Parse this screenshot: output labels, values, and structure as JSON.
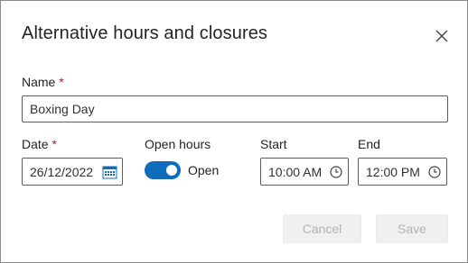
{
  "dialog": {
    "title": "Alternative hours and closures",
    "close_icon": "close-icon"
  },
  "name_field": {
    "label": "Name",
    "required_mark": "*",
    "value": "Boxing Day"
  },
  "date_field": {
    "label": "Date",
    "required_mark": "*",
    "value": "26/12/2022",
    "icon": "calendar-icon"
  },
  "open_hours": {
    "label": "Open hours",
    "toggle_on": true,
    "toggle_text": "Open"
  },
  "start_field": {
    "label": "Start",
    "value": "10:00 AM",
    "icon": "clock-icon"
  },
  "end_field": {
    "label": "End",
    "value": "12:00 PM",
    "icon": "clock-icon"
  },
  "buttons": {
    "cancel_label": "Cancel",
    "save_label": "Save"
  },
  "colors": {
    "accent": "#0f6cbd",
    "required": "#a4262c",
    "disabled_bg": "#f0f0f0",
    "disabled_text": "#b3b3b3"
  }
}
